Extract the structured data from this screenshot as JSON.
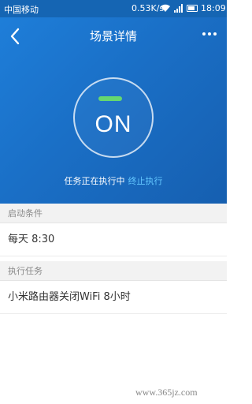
{
  "statusbar": {
    "carrier": "中国移动",
    "speed": "0.53K/s",
    "time": "18:09"
  },
  "header": {
    "back_icon": "chevron-left-icon",
    "title": "场景详情",
    "more_icon": "more-horizontal-icon"
  },
  "scene": {
    "state": "ON",
    "status_text": "任务正在执行中",
    "stop_label": "终止执行",
    "indicator_color": "#66d86f",
    "accent_color": "#1a6fc6",
    "link_color": "#64c8ff"
  },
  "sections": {
    "trigger": {
      "header": "启动条件",
      "value": "每天 8:30"
    },
    "task": {
      "header": "执行任务",
      "value": "小米路由器关闭WiFi 8小时"
    }
  },
  "watermark": "www.365jz.com"
}
